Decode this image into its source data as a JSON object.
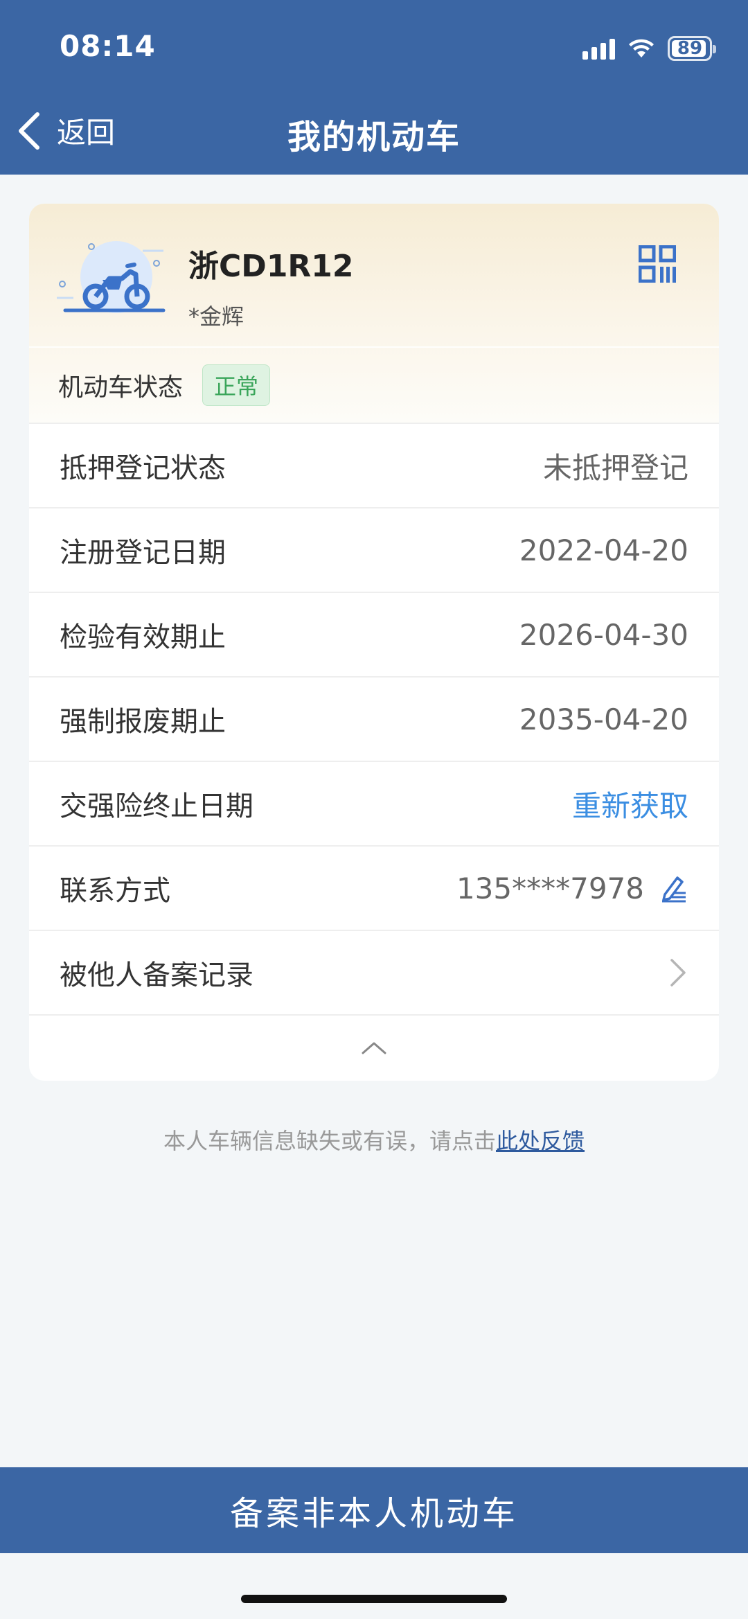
{
  "status_bar": {
    "time": "08:14",
    "battery": "89"
  },
  "nav": {
    "back_label": "返回",
    "title": "我的机动车"
  },
  "vehicle": {
    "plate": "浙CD1R12",
    "owner": "*金辉",
    "status_label": "机动车状态",
    "status_value": "正常"
  },
  "details": [
    {
      "label": "抵押登记状态",
      "value": "未抵押登记"
    },
    {
      "label": "注册登记日期",
      "value": "2022-04-20"
    },
    {
      "label": "检验有效期止",
      "value": "2026-04-30"
    },
    {
      "label": "强制报废期止",
      "value": "2035-04-20"
    },
    {
      "label": "交强险终止日期",
      "value": "重新获取"
    },
    {
      "label": "联系方式",
      "value": "135****7978"
    },
    {
      "label": "被他人备案记录"
    }
  ],
  "feedback": {
    "text": "本人车辆信息缺失或有误，请点击",
    "link": "此处反馈"
  },
  "bottom_button": {
    "label": "备案非本人机动车"
  },
  "colors": {
    "primary": "#3b66a4",
    "link": "#3b8ee2",
    "status_green": "#3aa55a"
  }
}
